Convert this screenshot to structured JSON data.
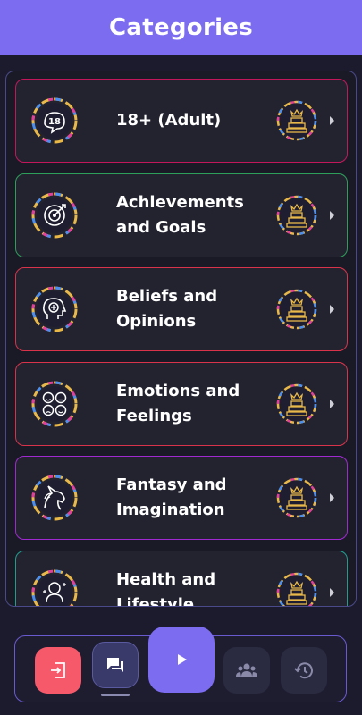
{
  "header": {
    "title": "Categories"
  },
  "categories": [
    {
      "label": "18+ (Adult)",
      "icon": "adult-18-icon",
      "border": "#c2185b"
    },
    {
      "label": "Achievements and Goals",
      "icon": "target-icon",
      "border": "#2e9e5b"
    },
    {
      "label": "Beliefs and Opinions",
      "icon": "head-gears-icon",
      "border": "#d8334a"
    },
    {
      "label": "Emotions and Feelings",
      "icon": "emoji-faces-icon",
      "border": "#d8334a"
    },
    {
      "label": "Fantasy and Imagination",
      "icon": "unicorn-icon",
      "border": "#a02ad0"
    },
    {
      "label": "Health and Lifestyle",
      "icon": "health-icon",
      "border": "#1f9e8e"
    }
  ],
  "nav": {
    "exit": "exit-icon",
    "chat": "chat-icon",
    "play": "play-icon",
    "group": "group-icon",
    "history": "history-icon",
    "active": "chat"
  },
  "colors": {
    "accent": "#7c6cf0",
    "exit": "#f5596a",
    "ring_gold": "#e8b94a"
  }
}
